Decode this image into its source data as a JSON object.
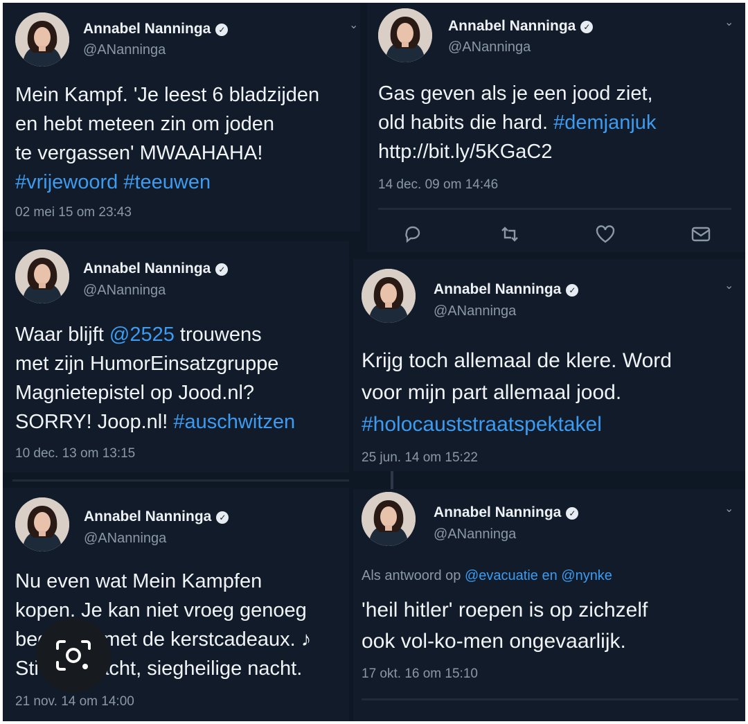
{
  "tweets": [
    {
      "name": "Annabel Nanninga",
      "handle": "@ANanninga",
      "lines": [
        {
          "text": "Mein Kampf. 'Je leest 6 bladzijden",
          "link": ""
        },
        {
          "text": "en hebt meteen zin om joden",
          "link": ""
        },
        {
          "text": "te vergassen' MWAAHAHA!",
          "link": ""
        },
        {
          "text": "",
          "link": "#vrijewoord #teeuwen"
        }
      ],
      "timestamp": "02 mei 15 om 23:43"
    },
    {
      "name": "Annabel Nanninga",
      "handle": "@ANanninga",
      "lines": [
        {
          "text": "Gas geven als je een jood ziet,",
          "link": ""
        },
        {
          "text": "old habits die hard. ",
          "link": "#demjanjuk"
        },
        {
          "text": "http://bit.ly/5KGaC2",
          "link": ""
        }
      ],
      "timestamp": "14 dec. 09 om 14:46",
      "actions": [
        "reply-icon",
        "retweet-icon",
        "like-icon",
        "message-icon"
      ]
    },
    {
      "name": "Annabel Nanninga",
      "handle": "@ANanninga",
      "lines": [
        {
          "text": "Waar blijft ",
          "link": "@2525",
          "after": " trouwens"
        },
        {
          "text": "met zijn HumorEinsatzgruppe",
          "link": ""
        },
        {
          "text": "Magnietepistel op Jood.nl?",
          "link": ""
        },
        {
          "text": "SORRY! Joop.nl! ",
          "link": "#auschwitzen"
        }
      ],
      "timestamp": "10 dec. 13 om 13:15"
    },
    {
      "name": "Annabel Nanninga",
      "handle": "@ANanninga",
      "lines": [
        {
          "text": "Krijg toch allemaal de klere. Word",
          "link": ""
        },
        {
          "text": "voor mijn part allemaal jood.",
          "link": ""
        },
        {
          "text": "",
          "link": "#holocauststraatspektakel"
        }
      ],
      "timestamp": "25 jun. 14 om 15:22"
    },
    {
      "name": "Annabel Nanninga",
      "handle": "@ANanninga",
      "lines": [
        {
          "text": "Nu even wat Mein Kampfen",
          "link": ""
        },
        {
          "text": "kopen. Je kan niet vroeg genoeg",
          "link": ""
        },
        {
          "text": "beginnen met de kerstcadeaux. ♪",
          "link": ""
        },
        {
          "text": "Sti-hille nacht, siegheilige nacht.",
          "link": ""
        }
      ],
      "timestamp": "21 nov. 14 om 14:00"
    },
    {
      "name": "Annabel Nanninga",
      "handle": "@ANanninga",
      "reply_prefix": "Als antwoord op ",
      "reply_to": "@evacuatie en @nynke",
      "lines": [
        {
          "text": "'heil hitler' roepen is op zichzelf",
          "link": ""
        },
        {
          "text": "ook vol-ko-men ongevaarlijk.",
          "link": ""
        }
      ],
      "timestamp": "17 okt. 16 om 15:10"
    }
  ],
  "icons": {
    "verified": "verified-badge-icon",
    "chevron": "chevron-down-icon",
    "lens": "google-lens-icon"
  },
  "colors": {
    "background": "#0e1724",
    "card": "#111b29",
    "link": "#3d9bf0",
    "text": "#f1f4f7",
    "muted": "#8b98a6"
  }
}
